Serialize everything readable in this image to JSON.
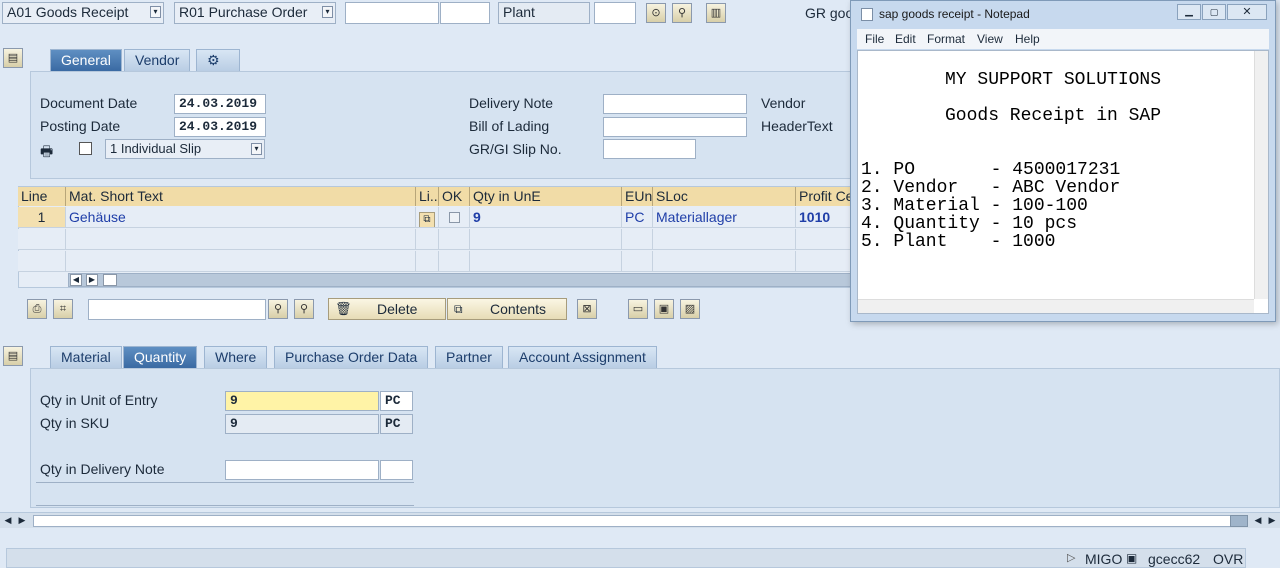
{
  "header": {
    "transaction": "A01 Goods Receipt",
    "reference": "R01 Purchase Order",
    "plant_label": "Plant",
    "gr_label": "GR goo"
  },
  "header_tabs": [
    "General",
    "Vendor"
  ],
  "general": {
    "doc_date_label": "Document Date",
    "doc_date": "24.03.2019",
    "post_date_label": "Posting Date",
    "post_date": "24.03.2019",
    "slip_option": "1 Individual Slip",
    "delivery_note_label": "Delivery Note",
    "bill_of_lading_label": "Bill of Lading",
    "slip_no_label": "GR/GI Slip No.",
    "vendor_label": "Vendor",
    "header_text_label": "HeaderText"
  },
  "items_table": {
    "headers": [
      "Line",
      "Mat. Short Text",
      "Li...",
      "OK",
      "Qty in UnE",
      "EUn",
      "SLoc",
      "Profit Ce"
    ],
    "rows": [
      {
        "line": "1",
        "text": "Gehäuse",
        "qty": "9",
        "eun": "PC",
        "sloc": "Materiallager",
        "profit": "1010"
      }
    ]
  },
  "toolbar": {
    "delete_label": "Delete",
    "contents_label": "Contents"
  },
  "detail_tabs": [
    "Material",
    "Quantity",
    "Where",
    "Purchase Order Data",
    "Partner",
    "Account Assignment"
  ],
  "quantity": {
    "qty_entry_label": "Qty in Unit of Entry",
    "qty_entry": "9",
    "qty_entry_unit": "PC",
    "qty_sku_label": "Qty in SKU",
    "qty_sku": "9",
    "qty_sku_unit": "PC",
    "qty_delivery_label": "Qty in Delivery Note"
  },
  "status": {
    "tcode": "MIGO",
    "server": "gcecc62",
    "mode": "OVR"
  },
  "notepad": {
    "title": "sap goods receipt - Notepad",
    "menu": [
      "File",
      "Edit",
      "Format",
      "View",
      "Help"
    ],
    "line1": "MY SUPPORT SOLUTIONS",
    "line2": "Goods Receipt in SAP",
    "items": [
      "1. PO       - 4500017231",
      "2. Vendor   - ABC Vendor",
      "3. Material - 100-100",
      "4. Quantity - 10 pcs",
      "5. Plant    - 1000"
    ]
  },
  "colors": {
    "tab_active": "#3a6aa3",
    "header_row": "#f1dca7",
    "background": "#dfe9f5"
  }
}
